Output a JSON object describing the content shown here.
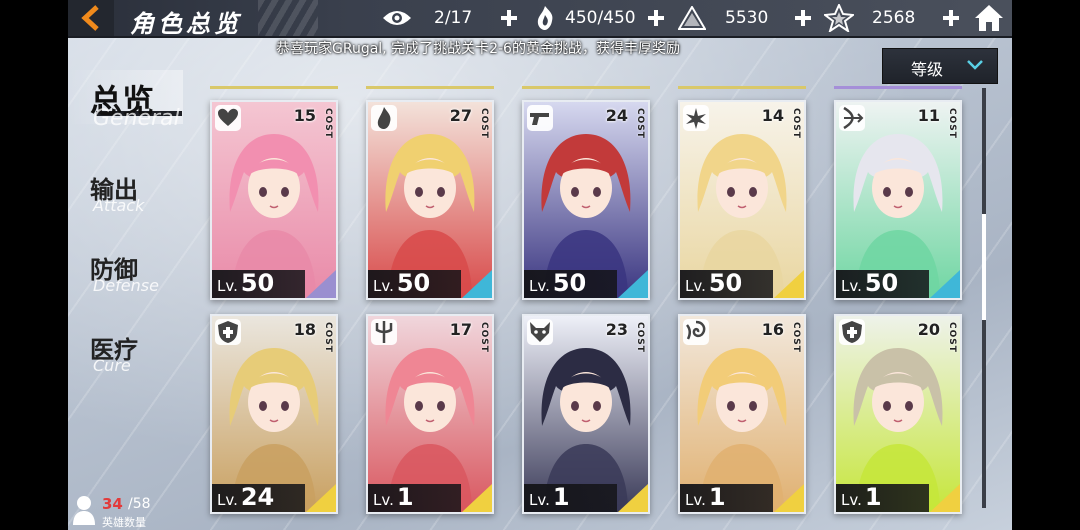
{
  "header": {
    "title": "角色总览",
    "resources": [
      {
        "name": "vision",
        "icon": "eye-icon",
        "value": "2/17"
      },
      {
        "name": "stamina",
        "icon": "flame-hand-icon",
        "value": "450/450"
      },
      {
        "name": "crystal",
        "icon": "pyramid-icon",
        "value": "5530"
      },
      {
        "name": "star",
        "icon": "star-shard-icon",
        "value": "2568"
      }
    ]
  },
  "notice": "恭喜玩家GRugal, 完成了挑战关卡2-6的黄金挑战，获得丰厚奖励",
  "sidebar": {
    "items": [
      {
        "zh": "总览",
        "en": "General",
        "active": true
      },
      {
        "zh": "输出",
        "en": "Attack",
        "active": false
      },
      {
        "zh": "防御",
        "en": "Defense",
        "active": false
      },
      {
        "zh": "医疗",
        "en": "Cure",
        "active": false
      }
    ]
  },
  "sort": {
    "label": "等级"
  },
  "cost_label": "COST",
  "level_prefix": "Lv.",
  "cards": [
    {
      "cost": "15",
      "level": "50",
      "emblem": "heart-wing-icon",
      "accent": "#9a8fd0",
      "top": "#d9c86a",
      "bg": [
        "#f4c6d2",
        "#e98aa8"
      ],
      "hair": "#f28fb0"
    },
    {
      "cost": "27",
      "level": "50",
      "emblem": "flame-icon",
      "accent": "#3fb7d8",
      "top": "#d9c86a",
      "bg": [
        "#f3e2da",
        "#d84a4a"
      ],
      "hair": "#f0d070"
    },
    {
      "cost": "24",
      "level": "50",
      "emblem": "pistol-icon",
      "accent": "#3fb7d8",
      "top": "#d9c86a",
      "bg": [
        "#d6d8ef",
        "#3a3580"
      ],
      "hair": "#c23a3a"
    },
    {
      "cost": "14",
      "level": "50",
      "emblem": "lotus-icon",
      "accent": "#f0d040",
      "top": "#d9c86a",
      "bg": [
        "#f7f3ea",
        "#e9d6a0"
      ],
      "hair": "#f1d58a"
    },
    {
      "cost": "11",
      "level": "50",
      "emblem": "bow-icon",
      "accent": "#3fb7d8",
      "top": "#a58fd8",
      "bg": [
        "#eef3f2",
        "#6fd6a2"
      ],
      "hair": "#e6e6ee"
    },
    {
      "cost": "18",
      "level": "24",
      "emblem": "shield-cross-icon",
      "accent": "#f0d040",
      "top": "#d9c86a",
      "bg": [
        "#eae6de",
        "#c9a060"
      ],
      "hair": "#e7cc78"
    },
    {
      "cost": "17",
      "level": "1",
      "emblem": "trident-icon",
      "accent": "#f0d040",
      "top": "#d9c86a",
      "bg": [
        "#f0d6dc",
        "#d9575f"
      ],
      "hair": "#ef8694"
    },
    {
      "cost": "23",
      "level": "1",
      "emblem": "fox-mask-icon",
      "accent": "#f0d040",
      "top": "#d9c86a",
      "bg": [
        "#eef0f8",
        "#3a3a58"
      ],
      "hair": "#2c2c44"
    },
    {
      "cost": "16",
      "level": "1",
      "emblem": "swirl-icon",
      "accent": "#f0d040",
      "top": "#d9c86a",
      "bg": [
        "#f2e8dc",
        "#e0b070"
      ],
      "hair": "#f2cc78"
    },
    {
      "cost": "20",
      "level": "1",
      "emblem": "shield-cross-icon",
      "accent": "#f0d040",
      "top": "#d9c86a",
      "bg": [
        "#eef2ea",
        "#c6e63a"
      ],
      "hair": "#c9c1a8"
    }
  ],
  "hero_count": {
    "current": "34",
    "max": "/58",
    "label": "英雄数量"
  }
}
